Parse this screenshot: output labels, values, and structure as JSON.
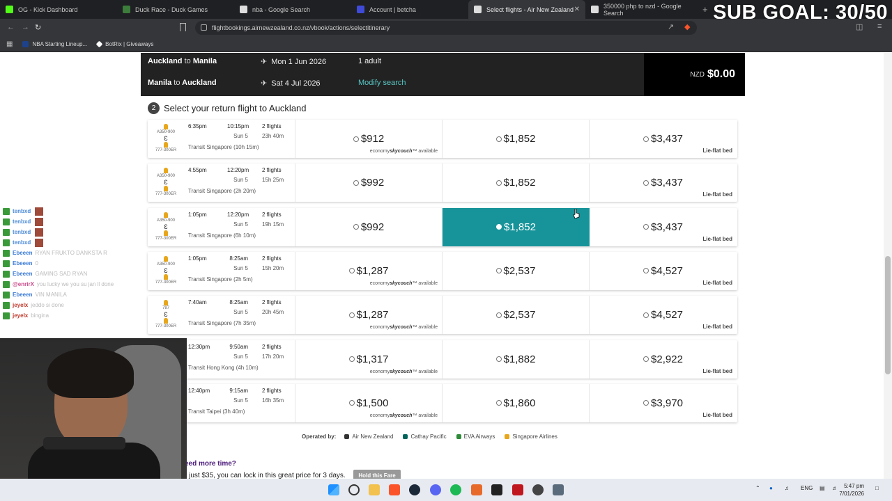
{
  "browser": {
    "tabs": [
      {
        "title": "OG - Kick Dashboard",
        "color": "#53fc18",
        "active": false
      },
      {
        "title": "Duck Race - Duck Games",
        "color": "#3c7d3c",
        "active": false
      },
      {
        "title": "nba - Google Search",
        "color": "#dddddd",
        "active": false
      },
      {
        "title": "Account | betcha",
        "color": "#3f4bd8",
        "active": false
      },
      {
        "title": "Select flights - Air New Zealand",
        "color": "#dddddd",
        "active": true
      },
      {
        "title": "350000 php to nzd - Google Search",
        "color": "#dddddd",
        "active": false
      }
    ],
    "url": "flightbookings.airnewzealand.co.nz/vbook/actions/selectitinerary",
    "bookmarks": [
      {
        "label": "NBA Starting Lineup...",
        "color": "#1d428a"
      },
      {
        "label": "BotRix | Giveaways",
        "color": "#ffffff"
      }
    ]
  },
  "overlay": {
    "sub_goal": "SUB GOAL: 30/50"
  },
  "summary": {
    "outbound": {
      "from": "Auckland",
      "to_word": "to",
      "to": "Manila",
      "date": "Mon 1 Jun 2026",
      "pax": "1 adult"
    },
    "return": {
      "from": "Manila",
      "to_word": "to",
      "to": "Auckland",
      "date": "Sat 4 Jul 2026",
      "modify": "Modify search"
    },
    "total_currency": "NZD",
    "total_amount": "$0.00"
  },
  "step": {
    "number": "2",
    "title": "Select your return flight to Auckland"
  },
  "flights": [
    {
      "aircraft": [
        "A350-900",
        "777-300ER"
      ],
      "dep": "6:35pm",
      "arr": "10:15pm",
      "arr_day": "Sun 5",
      "stops": "2 flights",
      "duration": "23h 40m",
      "transit": "Transit Singapore (10h 15m)",
      "fares": [
        {
          "price": "$912",
          "note_pre": "economy",
          "note_brand": "skycouch",
          "note_post": "™ available"
        },
        {
          "price": "$1,852",
          "note_pre": "",
          "note_brand": "",
          "note_post": ""
        },
        {
          "price": "$3,437",
          "note_pre": "",
          "note_brand": "",
          "note_post": "Lie-flat bed"
        }
      ],
      "selected": -1
    },
    {
      "aircraft": [
        "A350-900",
        "777-300ER"
      ],
      "dep": "4:55pm",
      "arr": "12:20pm",
      "arr_day": "Sun 5",
      "stops": "2 flights",
      "duration": "15h 25m",
      "transit": "Transit Singapore (2h 20m)",
      "fares": [
        {
          "price": "$992",
          "note_pre": "",
          "note_brand": "",
          "note_post": ""
        },
        {
          "price": "$1,852",
          "note_pre": "",
          "note_brand": "",
          "note_post": ""
        },
        {
          "price": "$3,437",
          "note_pre": "",
          "note_brand": "",
          "note_post": "Lie-flat bed"
        }
      ],
      "selected": -1
    },
    {
      "aircraft": [
        "A350-900",
        "777-300ER"
      ],
      "dep": "1:05pm",
      "arr": "12:20pm",
      "arr_day": "Sun 5",
      "stops": "2 flights",
      "duration": "19h 15m",
      "transit": "Transit Singapore (6h 10m)",
      "fares": [
        {
          "price": "$992",
          "note_pre": "",
          "note_brand": "",
          "note_post": ""
        },
        {
          "price": "$1,852",
          "note_pre": "",
          "note_brand": "",
          "note_post": ""
        },
        {
          "price": "$3,437",
          "note_pre": "",
          "note_brand": "",
          "note_post": "Lie-flat bed"
        }
      ],
      "selected": 1
    },
    {
      "aircraft": [
        "A350-900",
        "777-300ER"
      ],
      "dep": "1:05pm",
      "arr": "8:25am",
      "arr_day": "Sun 5",
      "stops": "2 flights",
      "duration": "15h 20m",
      "transit": "Transit Singapore (2h 5m)",
      "fares": [
        {
          "price": "$1,287",
          "note_pre": "economy",
          "note_brand": "skycouch",
          "note_post": "™ available"
        },
        {
          "price": "$2,537",
          "note_pre": "",
          "note_brand": "",
          "note_post": ""
        },
        {
          "price": "$4,527",
          "note_pre": "",
          "note_brand": "",
          "note_post": "Lie-flat bed"
        }
      ],
      "selected": -1
    },
    {
      "aircraft": [
        "787",
        "777-300ER"
      ],
      "dep": "7:40am",
      "arr": "8:25am",
      "arr_day": "Sun 5",
      "stops": "2 flights",
      "duration": "20h 45m",
      "transit": "Transit Singapore (7h 35m)",
      "fares": [
        {
          "price": "$1,287",
          "note_pre": "economy",
          "note_brand": "skycouch",
          "note_post": "™ available"
        },
        {
          "price": "$2,537",
          "note_pre": "",
          "note_brand": "",
          "note_post": ""
        },
        {
          "price": "$4,527",
          "note_pre": "",
          "note_brand": "",
          "note_post": "Lie-flat bed"
        }
      ],
      "selected": -1
    },
    {
      "aircraft": [],
      "dep": "12:30pm",
      "arr": "9:50am",
      "arr_day": "Sun 5",
      "stops": "2 flights",
      "duration": "17h 20m",
      "transit": "Transit Hong Kong (4h 10m)",
      "fares": [
        {
          "price": "$1,317",
          "note_pre": "economy",
          "note_brand": "skycouch",
          "note_post": "™ available"
        },
        {
          "price": "$1,882",
          "note_pre": "",
          "note_brand": "",
          "note_post": ""
        },
        {
          "price": "$2,922",
          "note_pre": "",
          "note_brand": "",
          "note_post": "Lie-flat bed"
        }
      ],
      "selected": -1
    },
    {
      "aircraft": [],
      "dep": "12:40pm",
      "arr": "9:15am",
      "arr_day": "Sun 5",
      "stops": "2 flights",
      "duration": "16h 35m",
      "transit": "Transit Taipei (3h 40m)",
      "fares": [
        {
          "price": "$1,500",
          "note_pre": "economy",
          "note_brand": "skycouch",
          "note_post": "™ available"
        },
        {
          "price": "$1,860",
          "note_pre": "",
          "note_brand": "",
          "note_post": ""
        },
        {
          "price": "$3,970",
          "note_pre": "",
          "note_brand": "",
          "note_post": "Lie-flat bed"
        }
      ],
      "selected": -1
    }
  ],
  "operated": {
    "label": "Operated by:",
    "airlines": [
      {
        "name": "Air New Zealand",
        "color": "#333333"
      },
      {
        "name": "Cathay Pacific",
        "color": "#00645a"
      },
      {
        "name": "EVA Airways",
        "color": "#2e8b3a"
      },
      {
        "name": "Singapore Airlines",
        "color": "#e7a61b"
      }
    ]
  },
  "hold": {
    "heading": "eed more time?",
    "text": "r just $35, you can lock in this great price for 3 days.",
    "button": "Hold this Fare"
  },
  "chat": [
    {
      "user": "tenbxd",
      "color": "#4a8ad8",
      "msg": ""
    },
    {
      "user": "tenbxd",
      "color": "#4a8ad8",
      "msg": ""
    },
    {
      "user": "tenbxd",
      "color": "#4a8ad8",
      "msg": ""
    },
    {
      "user": "tenbxd",
      "color": "#4a8ad8",
      "msg": ""
    },
    {
      "user": "Ebeeen",
      "color": "#3b7bd6",
      "msg": "RYAN FRUKTO DANKSTA R"
    },
    {
      "user": "Ebeeen",
      "color": "#3b7bd6",
      "msg": "0"
    },
    {
      "user": "Ebeeen",
      "color": "#3b7bd6",
      "msg": "GAMING SAD RYAN"
    },
    {
      "user": "@enrirX",
      "color": "#c94a8a",
      "msg": "you lucky we you su jan ll done"
    },
    {
      "user": "Ebeeen",
      "color": "#3b7bd6",
      "msg": "VIN MANILA"
    },
    {
      "user": "jeyelx",
      "color": "#c0392b",
      "msg": "jeddo si done"
    },
    {
      "user": "jeyelx",
      "color": "#c0392b",
      "msg": "bingina"
    }
  ],
  "taskbar": {
    "lang": "ENG",
    "time": "5:47 pm",
    "date": "7/01/2026"
  }
}
